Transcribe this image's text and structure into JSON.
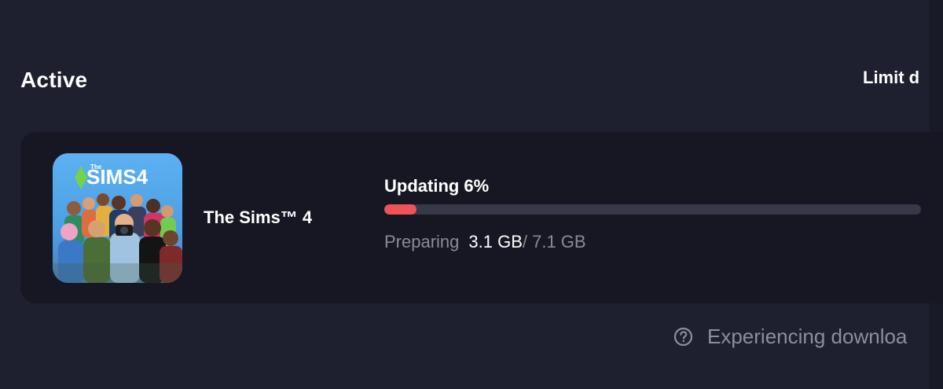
{
  "section": {
    "title": "Active"
  },
  "limit_link": {
    "label": "Limit d"
  },
  "download": {
    "game_title": "The Sims™ 4",
    "status": "Updating 6%",
    "progress_percent": 6,
    "phase": "Preparing",
    "current_size": "3.1 GB",
    "total_size": "/ 7.1 GB",
    "thumbnail_alt": "The Sims 4 cover art"
  },
  "help": {
    "icon": "question-circle-icon",
    "text": "Experiencing downloa"
  },
  "colors": {
    "background": "#1e1f2f",
    "card": "#161722",
    "accent": "#ef5358",
    "track": "#373848",
    "muted_text": "#8a8b98"
  }
}
